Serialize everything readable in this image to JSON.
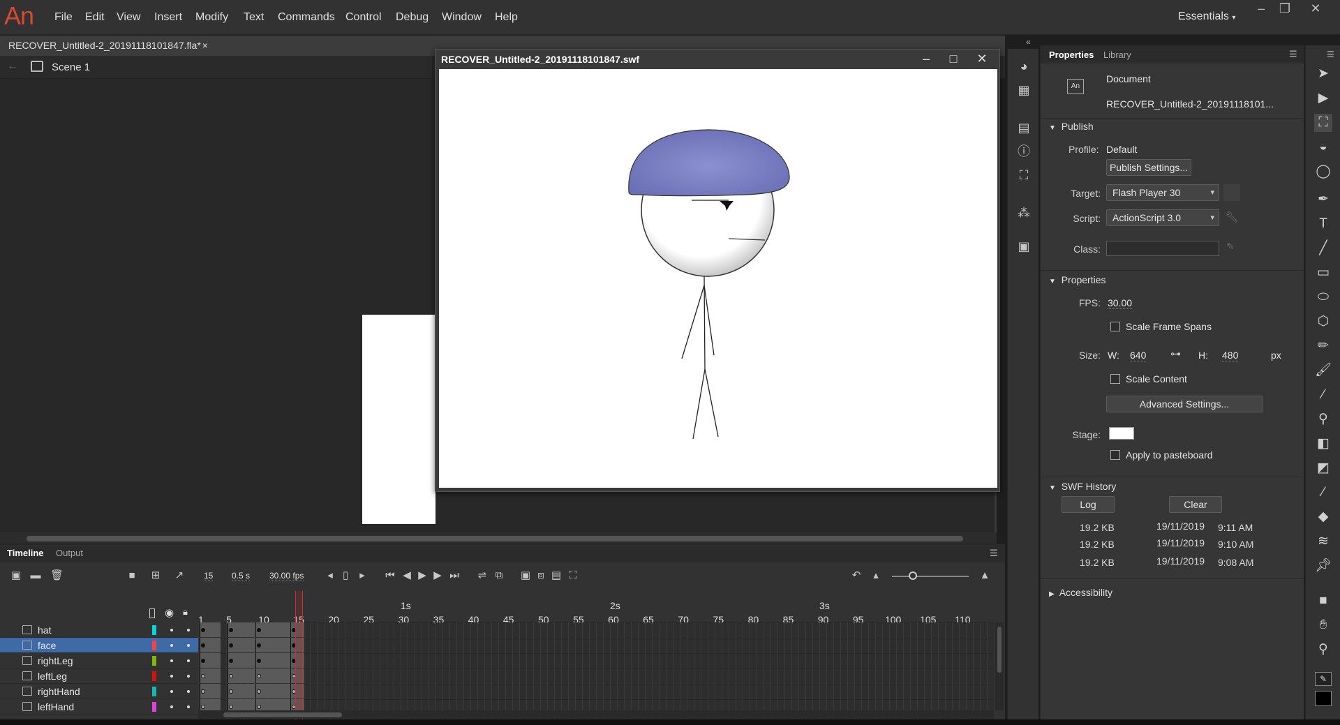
{
  "app": {
    "logo": "An",
    "menu": [
      "File",
      "Edit",
      "View",
      "Insert",
      "Modify",
      "Text",
      "Commands",
      "Control",
      "Debug",
      "Window",
      "Help"
    ],
    "workspace": "Essentials",
    "window_controls": [
      "–",
      "❐",
      "✕"
    ]
  },
  "document": {
    "tab_label": "RECOVER_Untitled-2_20191118101847.fla*",
    "tab_close": "×",
    "scene": "Scene 1"
  },
  "swf_window": {
    "title": "RECOVER_Untitled-2_20191118101847.swf",
    "controls": [
      "–",
      "□",
      "✕"
    ]
  },
  "timeline": {
    "tabs": [
      "Timeline",
      "Output"
    ],
    "current_frame": "15",
    "elapsed": "0.5 s",
    "fps": "30.00 fps",
    "seconds_markers": [
      "1s",
      "2s",
      "3s"
    ],
    "frame_numbers": [
      "1",
      "5",
      "10",
      "15",
      "20",
      "25",
      "30",
      "35",
      "40",
      "45",
      "50",
      "55",
      "60",
      "65",
      "70",
      "75",
      "80",
      "85",
      "90",
      "95",
      "100",
      "105",
      "110"
    ],
    "layers": [
      {
        "name": "hat",
        "color": "#00d8d8",
        "selected": false
      },
      {
        "name": "face",
        "color": "#ff4040",
        "selected": true
      },
      {
        "name": "rightLeg",
        "color": "#7fb800",
        "selected": false
      },
      {
        "name": "leftLeg",
        "color": "#d81010",
        "selected": false
      },
      {
        "name": "rightHand",
        "color": "#14b8b8",
        "selected": false
      },
      {
        "name": "leftHand",
        "color": "#e040e0",
        "selected": false
      }
    ]
  },
  "properties": {
    "tabs": [
      "Properties",
      "Library"
    ],
    "doc_type": "Document",
    "doc_name": "RECOVER_Untitled-2_20191118101...",
    "publish": {
      "header": "Publish",
      "profile_label": "Profile:",
      "profile_value": "Default",
      "settings_button": "Publish Settings...",
      "target_label": "Target:",
      "target_value": "Flash Player 30",
      "script_label": "Script:",
      "script_value": "ActionScript 3.0",
      "class_label": "Class:"
    },
    "props": {
      "header": "Properties",
      "fps_label": "FPS:",
      "fps_value": "30.00",
      "scale_frame_spans": "Scale Frame Spans",
      "size_label": "Size:",
      "w_label": "W:",
      "w_value": "640",
      "h_label": "H:",
      "h_value": "480",
      "unit": "px",
      "scale_content": "Scale Content",
      "advanced_button": "Advanced Settings...",
      "stage_label": "Stage:",
      "stage_color": "#ffffff",
      "apply_pasteboard": "Apply to pasteboard"
    },
    "swf_history": {
      "header": "SWF History",
      "log_button": "Log",
      "clear_button": "Clear",
      "entries": [
        {
          "size": "19.2 KB",
          "date": "19/11/2019",
          "time": "9:11 AM"
        },
        {
          "size": "19.2 KB",
          "date": "19/11/2019",
          "time": "9:10 AM"
        },
        {
          "size": "19.2 KB",
          "date": "19/11/2019",
          "time": "9:08 AM"
        }
      ]
    },
    "accessibility_header": "Accessibility"
  },
  "colors": {
    "accent_selection": "#3e6aa6",
    "playhead": "#c83030",
    "hat_fill": "#7b81c4",
    "logo": "#d74a2d"
  }
}
